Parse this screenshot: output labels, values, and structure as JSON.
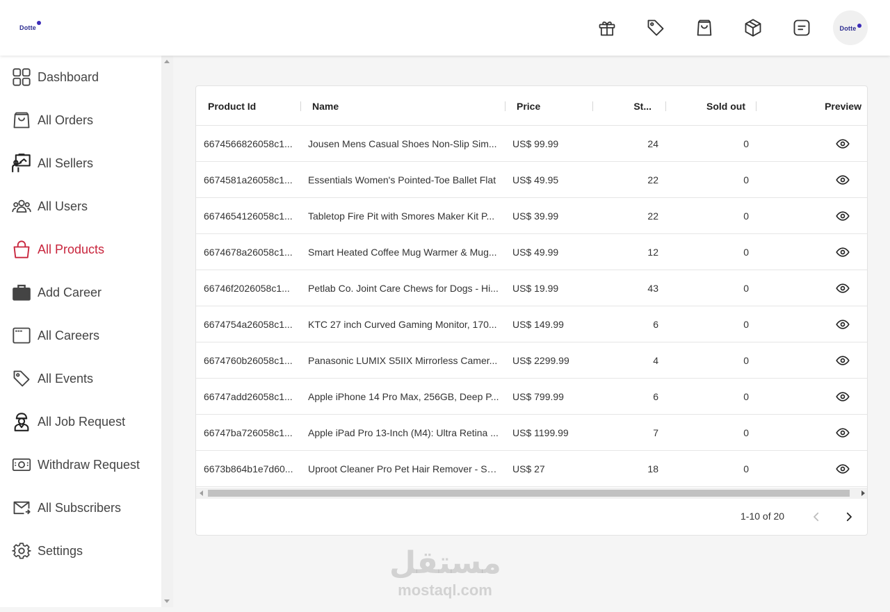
{
  "brand": {
    "logo_text": "Dotte",
    "accent": "#3b2bb8"
  },
  "header": {
    "icons": [
      "gift-icon",
      "tag-icon",
      "shopping-bag-icon",
      "package-icon",
      "note-icon"
    ],
    "avatar_text": "Dotte"
  },
  "sidebar": {
    "items": [
      {
        "label": "Dashboard",
        "icon": "grid-icon"
      },
      {
        "label": "All Orders",
        "icon": "shopping-bag-icon"
      },
      {
        "label": "All Sellers",
        "icon": "seller-board-icon"
      },
      {
        "label": "All Users",
        "icon": "users-icon"
      },
      {
        "label": "All Products",
        "icon": "handbag-icon",
        "active": true
      },
      {
        "label": "Add Career",
        "icon": "briefcase-icon"
      },
      {
        "label": "All Careers",
        "icon": "window-icon"
      },
      {
        "label": "All Events",
        "icon": "tag-icon"
      },
      {
        "label": "All Job Request",
        "icon": "worker-icon"
      },
      {
        "label": "Withdraw Request",
        "icon": "money-icon"
      },
      {
        "label": "All Subscribers",
        "icon": "mail-icon"
      },
      {
        "label": "Settings",
        "icon": "gear-icon"
      }
    ],
    "active_color": "#c8243c"
  },
  "table": {
    "columns": [
      "Product Id",
      "Name",
      "Price",
      "St...",
      "Sold out",
      "Preview"
    ],
    "rows": [
      {
        "id": "6674566826058c1...",
        "name": "Jousen Mens Casual Shoes Non-Slip Sim...",
        "price": "US$ 99.99",
        "stock": "24",
        "sold": "0"
      },
      {
        "id": "6674581a26058c1...",
        "name": "Essentials Women's Pointed-Toe Ballet Flat",
        "price": "US$ 49.95",
        "stock": "22",
        "sold": "0"
      },
      {
        "id": "6674654126058c1...",
        "name": "Tabletop Fire Pit with Smores Maker Kit P...",
        "price": "US$ 39.99",
        "stock": "22",
        "sold": "0"
      },
      {
        "id": "6674678a26058c1...",
        "name": "Smart Heated Coffee Mug Warmer & Mug...",
        "price": "US$ 49.99",
        "stock": "12",
        "sold": "0"
      },
      {
        "id": "66746f2026058c1...",
        "name": "Petlab Co. Joint Care Chews for Dogs - Hi...",
        "price": "US$ 19.99",
        "stock": "43",
        "sold": "0"
      },
      {
        "id": "6674754a26058c1...",
        "name": "KTC 27 inch Curved Gaming Monitor, 170...",
        "price": "US$ 149.99",
        "stock": "6",
        "sold": "0"
      },
      {
        "id": "6674760b26058c1...",
        "name": "Panasonic LUMIX S5IIX Mirrorless Camer...",
        "price": "US$ 2299.99",
        "stock": "4",
        "sold": "0"
      },
      {
        "id": "66747add26058c1...",
        "name": "Apple iPhone 14 Pro Max, 256GB, Deep P...",
        "price": "US$ 799.99",
        "stock": "6",
        "sold": "0"
      },
      {
        "id": "66747ba726058c1...",
        "name": "Apple iPad Pro 13-Inch (M4): Ultra Retina ...",
        "price": "US$ 1199.99",
        "stock": "7",
        "sold": "0"
      },
      {
        "id": "6673b864b1e7d60...",
        "name": "Uproot Cleaner Pro Pet Hair Remover - Sp...",
        "price": "US$ 27",
        "stock": "18",
        "sold": "0"
      }
    ],
    "pagination": "1-10 of 20"
  },
  "watermark": {
    "arabic": "مستقل",
    "latin": "mostaql.com"
  }
}
